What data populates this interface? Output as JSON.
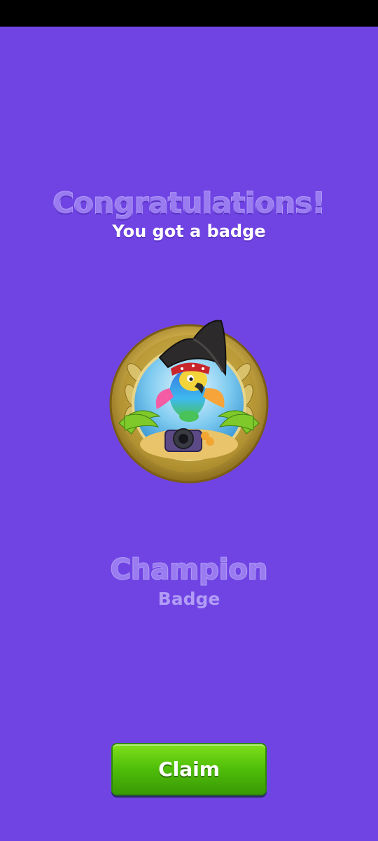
{
  "congrats": {
    "title": "Congratulations!",
    "subtitle": "You got a badge"
  },
  "badge": {
    "icon": "pirate-parrot-badge-icon",
    "name": "Champion",
    "type": "Badge"
  },
  "actions": {
    "claim_label": "Claim"
  },
  "colors": {
    "background": "#7044e3",
    "title": "#9a7cf0",
    "button": "#4fbd09"
  }
}
